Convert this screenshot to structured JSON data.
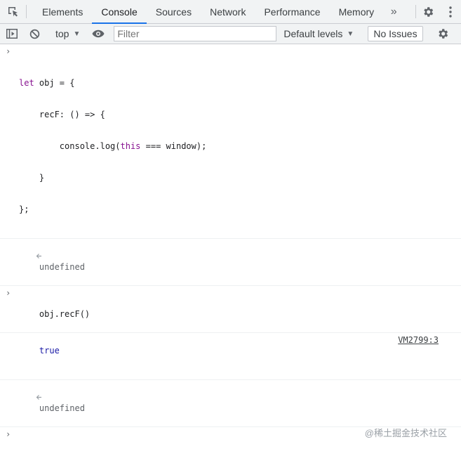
{
  "tabs": [
    "Elements",
    "Console",
    "Sources",
    "Network",
    "Performance",
    "Memory"
  ],
  "active_tab": "Console",
  "more_tabs_glyph": "»",
  "toolbar": {
    "context_label": "top",
    "filter_placeholder": "Filter",
    "levels_label": "Default levels",
    "issues_label": "No Issues"
  },
  "console": {
    "input1": {
      "l1_kw": "let",
      "l1_rest": " obj = {",
      "l2": "    recF: () => {",
      "l3_pre": "        console.log(",
      "l3_kw": "this",
      "l3_post": " === window);",
      "l4": "    }",
      "l5": "};"
    },
    "result1": "undefined",
    "input2": "obj.recF()",
    "log_value": "true",
    "log_source": "VM2799:3",
    "result2": "undefined"
  },
  "watermark": "@稀土掘金技术社区",
  "icons": {
    "inspect": "inspect-element-icon",
    "settings": "gear-icon",
    "menu": "kebab-menu-icon",
    "sidebar": "sidebar-toggle-icon",
    "clear": "clear-console-icon",
    "eye": "eye-icon"
  },
  "colors": {
    "accent": "#1a73e8",
    "keyword": "#881391",
    "boolean": "#1a1aa6"
  }
}
